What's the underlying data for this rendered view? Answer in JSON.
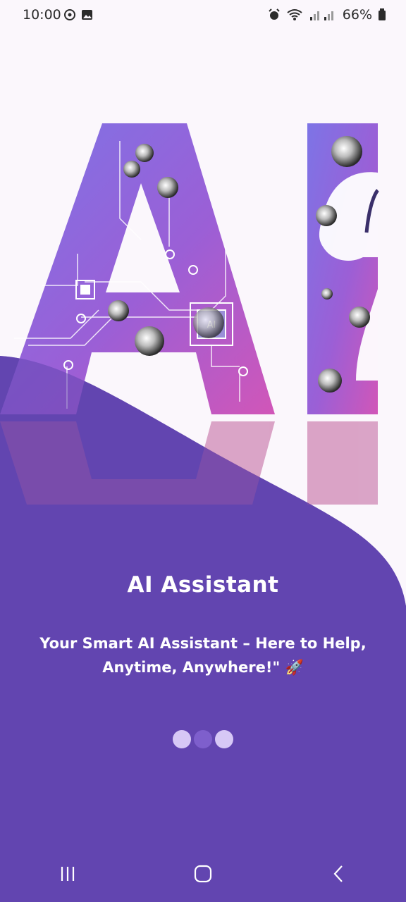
{
  "status_bar": {
    "time": "10:00",
    "battery": "66%"
  },
  "onboarding": {
    "title": "AI Assistant",
    "subtitle": "Your Smart AI Assistant – Here to Help, Anytime, Anywhere!\" 🚀",
    "page_index": 2,
    "page_count": 3
  },
  "theme": {
    "primary": "#6246b0",
    "background": "#fbf7fc",
    "dot_active": "#d7c8f6",
    "dot_inactive": "#7e5fcc"
  },
  "icons": {
    "nav_recents": "recents-icon",
    "nav_home": "home-icon",
    "nav_back": "back-icon"
  }
}
